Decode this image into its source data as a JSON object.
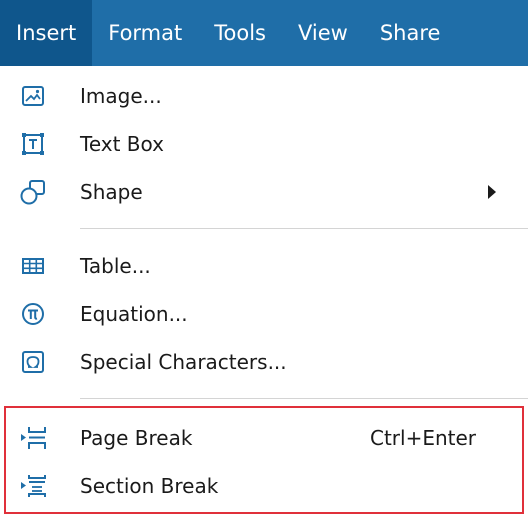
{
  "menubar": {
    "items": [
      {
        "label": "Insert",
        "active": true
      },
      {
        "label": "Format",
        "active": false
      },
      {
        "label": "Tools",
        "active": false
      },
      {
        "label": "View",
        "active": false
      },
      {
        "label": "Share",
        "active": false
      }
    ]
  },
  "insert_menu": {
    "items": [
      {
        "label": "Image...",
        "icon": "image-icon"
      },
      {
        "label": "Text Box",
        "icon": "text-box-icon"
      },
      {
        "label": "Shape",
        "icon": "shape-icon",
        "submenu": true
      },
      {
        "label": "Table...",
        "icon": "table-icon"
      },
      {
        "label": "Equation...",
        "icon": "equation-icon"
      },
      {
        "label": "Special Characters...",
        "icon": "special-characters-icon"
      },
      {
        "label": "Page Break",
        "icon": "page-break-icon",
        "shortcut": "Ctrl+Enter"
      },
      {
        "label": "Section Break",
        "icon": "section-break-icon"
      }
    ]
  },
  "colors": {
    "menubar_bg": "#1f6ea8",
    "menubar_active_bg": "#0f568c",
    "icon_blue": "#1f6ea8",
    "highlight_border": "#e0303a"
  }
}
